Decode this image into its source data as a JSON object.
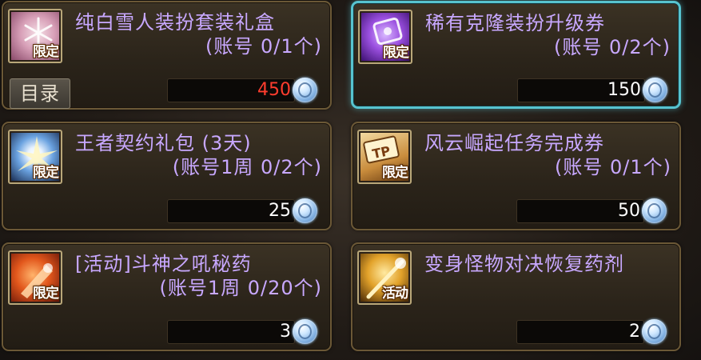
{
  "catalog_button": "目录",
  "items": [
    {
      "name": "纯白雪人装扮套装礼盒",
      "quota": "(账号 0/1个)",
      "badge": "限定",
      "price": "450",
      "price_color": "#ff3d2e",
      "icon_theme": "snowflake-icon"
    },
    {
      "name": "稀有克隆装扮升级券",
      "quota": "(账号 0/2个)",
      "badge": "限定",
      "price": "150",
      "price_color": "#ffffff",
      "icon_theme": "clone-ticket-icon"
    },
    {
      "name": "王者契约礼包 (3天)",
      "quota": "(账号1周 0/2个)",
      "badge": "限定",
      "price": "25",
      "price_color": "#ffffff",
      "icon_theme": "contract-burst-icon"
    },
    {
      "name": "风云崛起任务完成券",
      "quota": "(账号 0/1个)",
      "badge": "限定",
      "price": "50",
      "price_color": "#ffffff",
      "icon_theme": "tp-ticket-icon"
    },
    {
      "name": "[活动]斗神之吼秘药",
      "quota": "(账号1周 0/20个)",
      "badge": "限定",
      "price": "3",
      "price_color": "#ffffff",
      "icon_theme": "potion-icon"
    },
    {
      "name": "变身怪物对决恢复药剂",
      "quota": "",
      "badge": "活动",
      "price": "2",
      "price_color": "#ffffff",
      "icon_theme": "golden-staff-icon"
    }
  ],
  "selected_item_index": 1,
  "colors": {
    "item_name": "#c8a8ff",
    "selected_border": "#57c3cf",
    "card_border": "#6b5836"
  }
}
